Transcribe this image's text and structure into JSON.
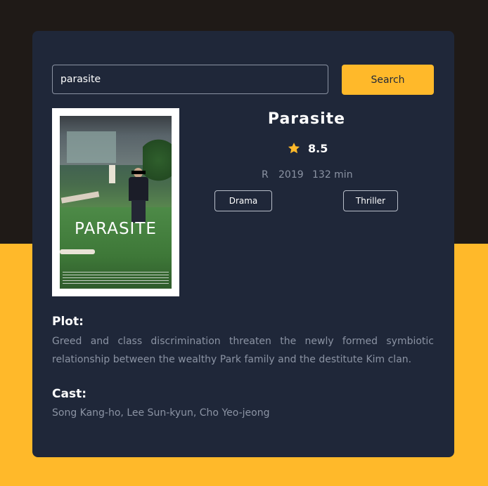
{
  "search": {
    "value": "parasite",
    "button_label": "Search"
  },
  "movie": {
    "title": "Parasite",
    "rating": "8.5",
    "rated": "R",
    "year": "2019",
    "runtime": "132 min",
    "genres": [
      "Drama",
      "Thriller"
    ],
    "poster": {
      "title": "PARASITE",
      "icon": "movie-poster"
    }
  },
  "plot": {
    "heading": "Plot:",
    "text": "Greed and class discrimination threaten the newly formed symbiotic relationship between the wealthy Park family and the destitute Kim clan."
  },
  "cast": {
    "heading": "Cast:",
    "text": "Song Kang-ho, Lee Sun-kyun, Cho Yeo-jeong"
  },
  "colors": {
    "accent": "#ffb92a",
    "card": "#1f2739",
    "muted_text": "#8b93a3",
    "top_background": "#1f1a17"
  }
}
